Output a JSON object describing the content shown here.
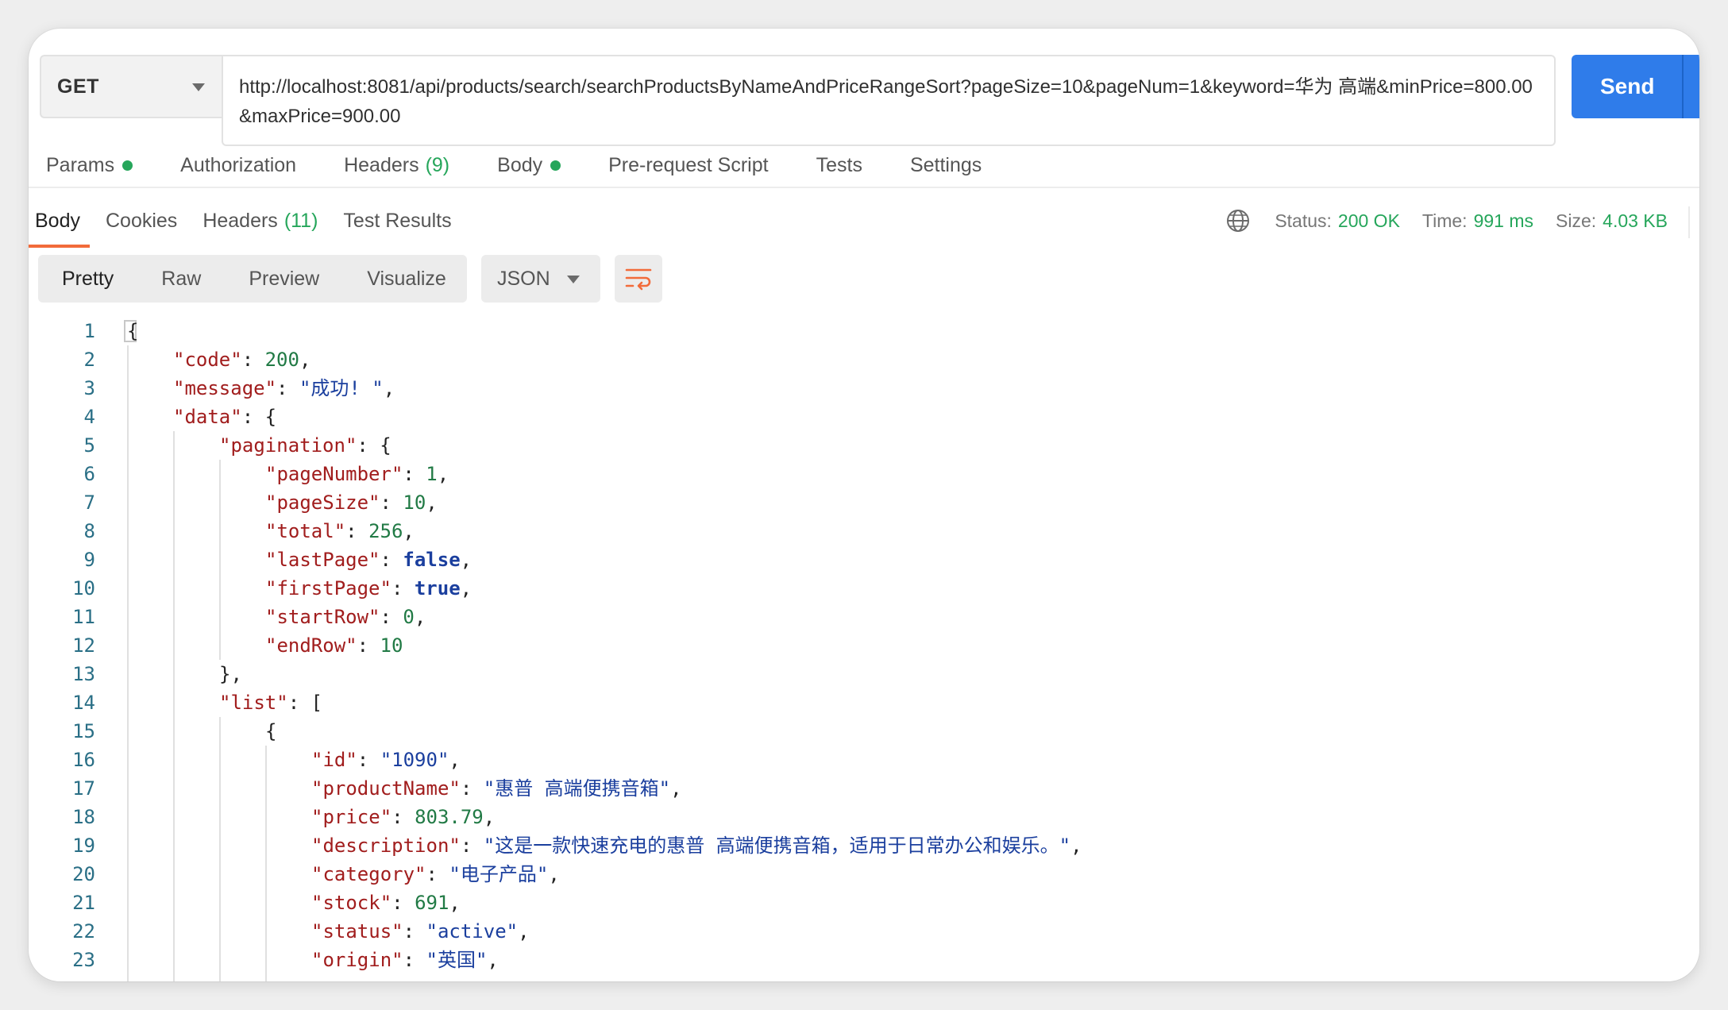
{
  "request": {
    "method": "GET",
    "url": "http://localhost:8081/api/products/search/searchProductsByNameAndPriceRangeSort?pageSize=10&pageNum=1&keyword=华为 高端&minPrice=800.00&maxPrice=900.00",
    "send_label": "Send"
  },
  "request_tabs": {
    "params": "Params",
    "authorization": "Authorization",
    "headers": "Headers",
    "headers_count": "(9)",
    "body": "Body",
    "prerequest": "Pre-request Script",
    "tests": "Tests",
    "settings": "Settings"
  },
  "response_tabs": {
    "body": "Body",
    "cookies": "Cookies",
    "headers": "Headers",
    "headers_count": "(11)",
    "test_results": "Test Results"
  },
  "status": {
    "status_label": "Status:",
    "status_value": "200 OK",
    "time_label": "Time:",
    "time_value": "991 ms",
    "size_label": "Size:",
    "size_value": "4.03 KB"
  },
  "view_modes": {
    "pretty": "Pretty",
    "raw": "Raw",
    "preview": "Preview",
    "visualize": "Visualize",
    "format": "JSON"
  },
  "colors": {
    "accent": "#2f7cea",
    "success": "#26a65b",
    "tab_underline": "#f26b3a",
    "json_key": "#a11d1d",
    "json_string": "#1b3f9e",
    "json_number": "#217a45"
  },
  "icons": {
    "globe": "globe-icon",
    "wrap": "wrap-lines-icon",
    "method_dropdown": "chevron-down-icon",
    "format_dropdown": "chevron-down-icon"
  },
  "code_lines": [
    {
      "n": "1",
      "indent": 0,
      "tokens": [
        [
          "p",
          "{"
        ]
      ]
    },
    {
      "n": "2",
      "indent": 1,
      "tokens": [
        [
          "k",
          "\"code\""
        ],
        [
          "p",
          ": "
        ],
        [
          "n",
          "200"
        ],
        [
          "p",
          ","
        ]
      ]
    },
    {
      "n": "3",
      "indent": 1,
      "tokens": [
        [
          "k",
          "\"message\""
        ],
        [
          "p",
          ": "
        ],
        [
          "s",
          "\"成功! \""
        ],
        [
          "p",
          ","
        ]
      ]
    },
    {
      "n": "4",
      "indent": 1,
      "tokens": [
        [
          "k",
          "\"data\""
        ],
        [
          "p",
          ": {"
        ]
      ]
    },
    {
      "n": "5",
      "indent": 2,
      "tokens": [
        [
          "k",
          "\"pagination\""
        ],
        [
          "p",
          ": {"
        ]
      ]
    },
    {
      "n": "6",
      "indent": 3,
      "tokens": [
        [
          "k",
          "\"pageNumber\""
        ],
        [
          "p",
          ": "
        ],
        [
          "n",
          "1"
        ],
        [
          "p",
          ","
        ]
      ]
    },
    {
      "n": "7",
      "indent": 3,
      "tokens": [
        [
          "k",
          "\"pageSize\""
        ],
        [
          "p",
          ": "
        ],
        [
          "n",
          "10"
        ],
        [
          "p",
          ","
        ]
      ]
    },
    {
      "n": "8",
      "indent": 3,
      "tokens": [
        [
          "k",
          "\"total\""
        ],
        [
          "p",
          ": "
        ],
        [
          "n",
          "256"
        ],
        [
          "p",
          ","
        ]
      ]
    },
    {
      "n": "9",
      "indent": 3,
      "tokens": [
        [
          "k",
          "\"lastPage\""
        ],
        [
          "p",
          ": "
        ],
        [
          "b",
          "false"
        ],
        [
          "p",
          ","
        ]
      ]
    },
    {
      "n": "10",
      "indent": 3,
      "tokens": [
        [
          "k",
          "\"firstPage\""
        ],
        [
          "p",
          ": "
        ],
        [
          "b",
          "true"
        ],
        [
          "p",
          ","
        ]
      ]
    },
    {
      "n": "11",
      "indent": 3,
      "tokens": [
        [
          "k",
          "\"startRow\""
        ],
        [
          "p",
          ": "
        ],
        [
          "n",
          "0"
        ],
        [
          "p",
          ","
        ]
      ]
    },
    {
      "n": "12",
      "indent": 3,
      "tokens": [
        [
          "k",
          "\"endRow\""
        ],
        [
          "p",
          ": "
        ],
        [
          "n",
          "10"
        ]
      ]
    },
    {
      "n": "13",
      "indent": 2,
      "tokens": [
        [
          "p",
          "},"
        ]
      ]
    },
    {
      "n": "14",
      "indent": 2,
      "tokens": [
        [
          "k",
          "\"list\""
        ],
        [
          "p",
          ": ["
        ]
      ]
    },
    {
      "n": "15",
      "indent": 3,
      "tokens": [
        [
          "p",
          "{"
        ]
      ]
    },
    {
      "n": "16",
      "indent": 4,
      "tokens": [
        [
          "k",
          "\"id\""
        ],
        [
          "p",
          ": "
        ],
        [
          "s",
          "\"1090\""
        ],
        [
          "p",
          ","
        ]
      ]
    },
    {
      "n": "17",
      "indent": 4,
      "tokens": [
        [
          "k",
          "\"productName\""
        ],
        [
          "p",
          ": "
        ],
        [
          "s",
          "\"惠普 高端便携音箱\""
        ],
        [
          "p",
          ","
        ]
      ]
    },
    {
      "n": "18",
      "indent": 4,
      "tokens": [
        [
          "k",
          "\"price\""
        ],
        [
          "p",
          ": "
        ],
        [
          "n",
          "803.79"
        ],
        [
          "p",
          ","
        ]
      ]
    },
    {
      "n": "19",
      "indent": 4,
      "tokens": [
        [
          "k",
          "\"description\""
        ],
        [
          "p",
          ": "
        ],
        [
          "s",
          "\"这是一款快速充电的惠普 高端便携音箱，适用于日常办公和娱乐。\""
        ],
        [
          "p",
          ","
        ]
      ]
    },
    {
      "n": "20",
      "indent": 4,
      "tokens": [
        [
          "k",
          "\"category\""
        ],
        [
          "p",
          ": "
        ],
        [
          "s",
          "\"电子产品\""
        ],
        [
          "p",
          ","
        ]
      ]
    },
    {
      "n": "21",
      "indent": 4,
      "tokens": [
        [
          "k",
          "\"stock\""
        ],
        [
          "p",
          ": "
        ],
        [
          "n",
          "691"
        ],
        [
          "p",
          ","
        ]
      ]
    },
    {
      "n": "22",
      "indent": 4,
      "tokens": [
        [
          "k",
          "\"status\""
        ],
        [
          "p",
          ": "
        ],
        [
          "s",
          "\"active\""
        ],
        [
          "p",
          ","
        ]
      ]
    },
    {
      "n": "23",
      "indent": 4,
      "tokens": [
        [
          "k",
          "\"origin\""
        ],
        [
          "p",
          ": "
        ],
        [
          "s",
          "\"英国\""
        ],
        [
          "p",
          ","
        ]
      ]
    }
  ]
}
